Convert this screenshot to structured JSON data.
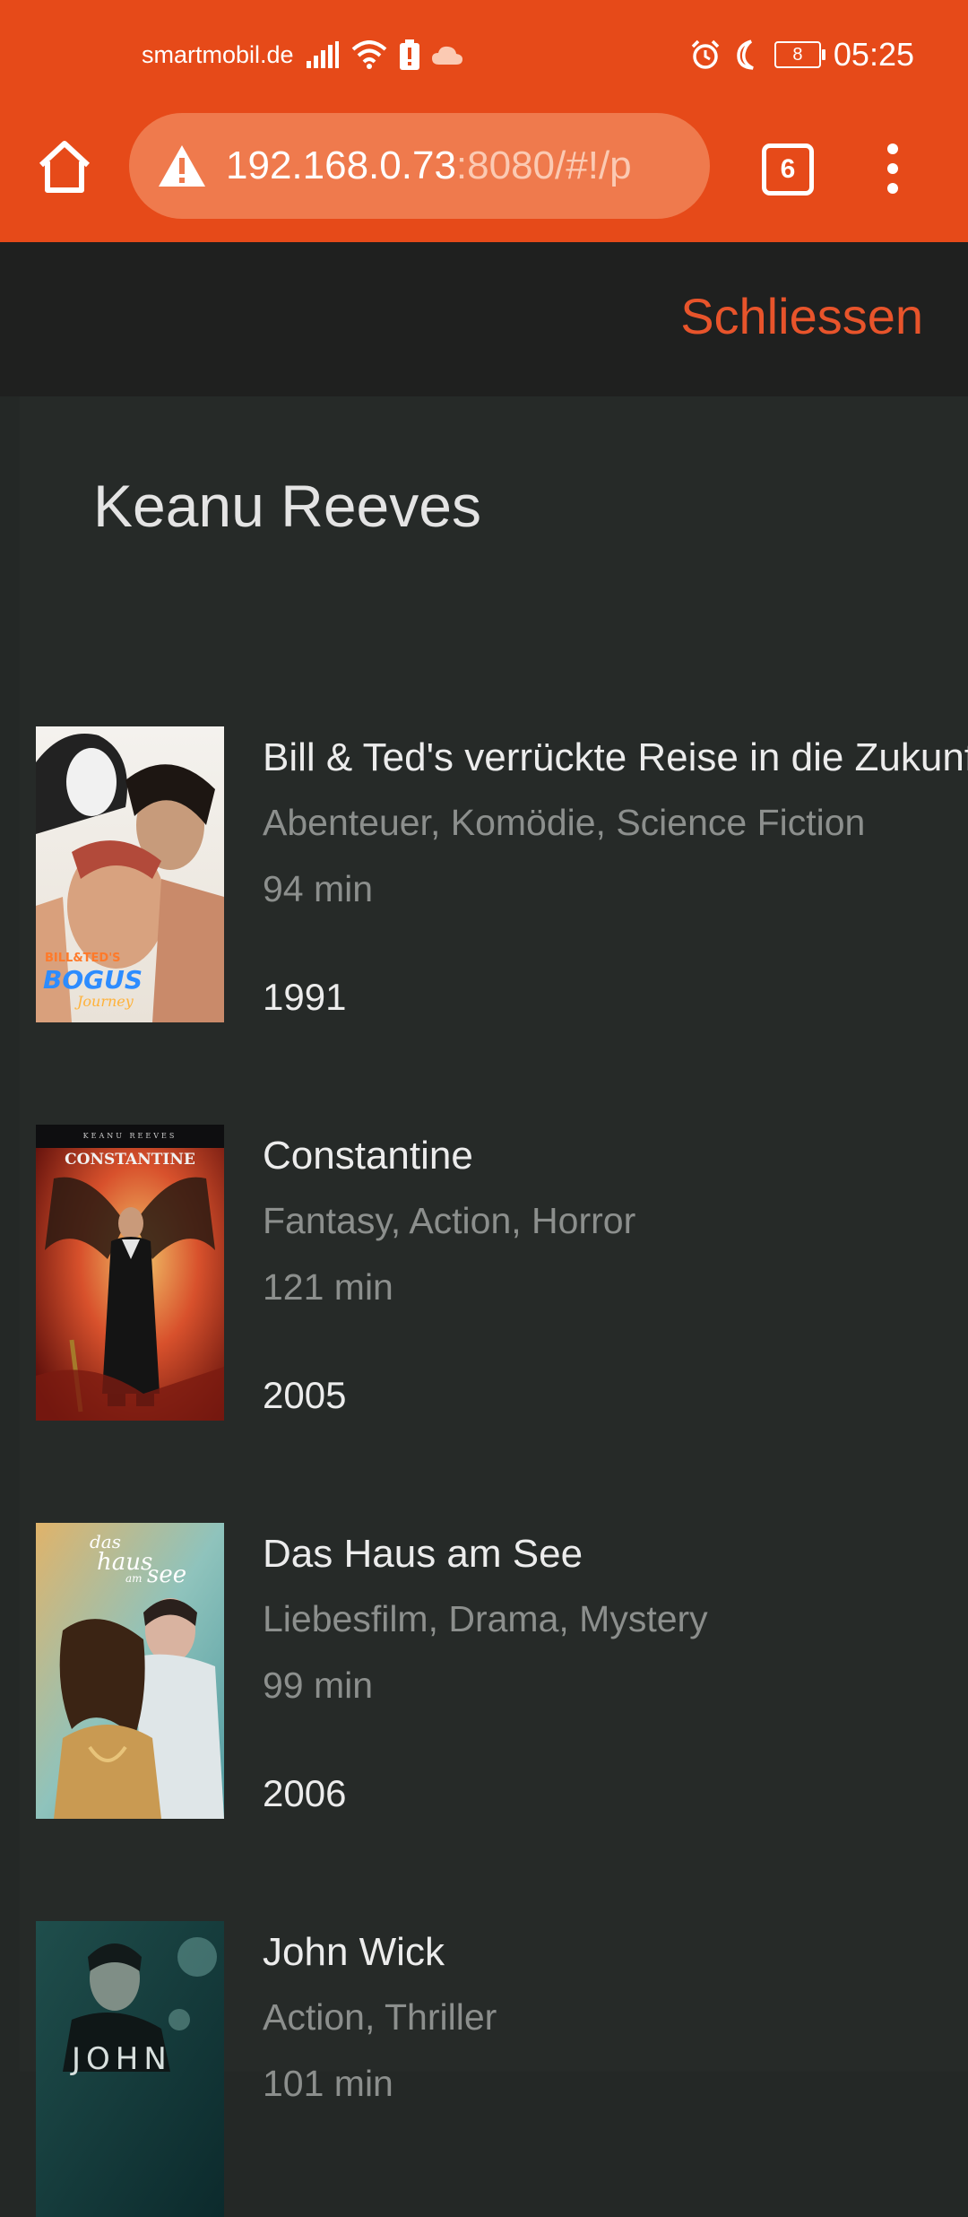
{
  "status_bar": {
    "carrier": "smartmobil.de",
    "battery": "8",
    "time": "05:25"
  },
  "browser": {
    "url_host": "192.168.0.73",
    "url_rest": ":8080/#!/p",
    "tab_count": "6"
  },
  "header": {
    "close_label": "Schliessen"
  },
  "person": {
    "name": "Keanu Reeves"
  },
  "movies": [
    {
      "title": "Bill & Ted's verrückte Reise in die Zukunft",
      "genres": "Abenteuer, Komödie, Science Fiction",
      "runtime": "94 min",
      "year": "1991"
    },
    {
      "title": "Constantine",
      "genres": "Fantasy, Action, Horror",
      "runtime": "121 min",
      "year": "2005"
    },
    {
      "title": "Das Haus am See",
      "genres": "Liebesfilm, Drama, Mystery",
      "runtime": "99 min",
      "year": "2006"
    },
    {
      "title": "John Wick",
      "genres": "Action, Thriller",
      "runtime": "101 min",
      "year": ""
    }
  ],
  "colors": {
    "accent": "#e64a19",
    "link": "#e8542b",
    "background": "#242826"
  }
}
